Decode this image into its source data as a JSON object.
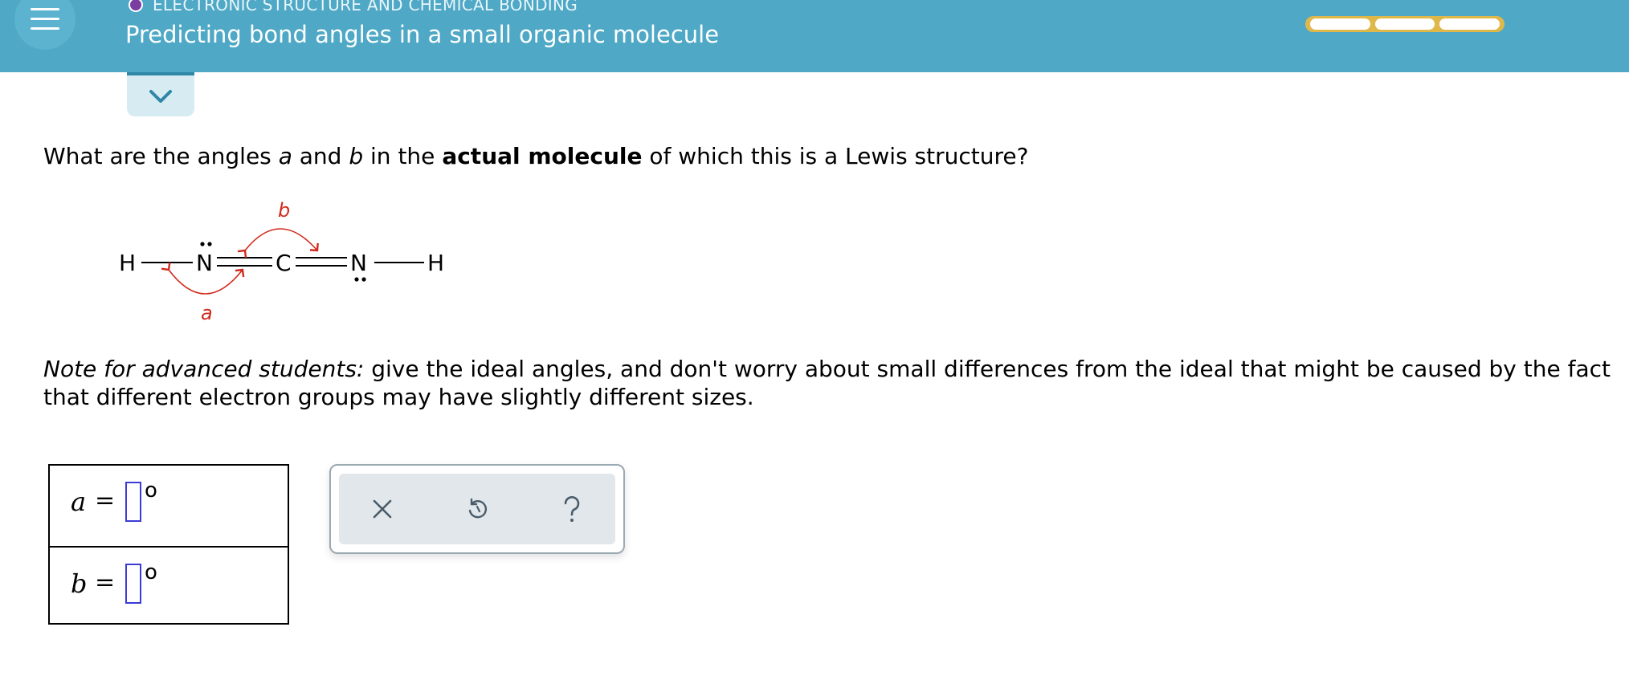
{
  "header": {
    "category": "ELECTRONIC STRUCTURE AND CHEMICAL BONDING",
    "title": "Predicting bond angles in a small organic molecule",
    "progress_segments": 3,
    "progress_filled": 0,
    "accent_color": "#4ea8c6",
    "progress_color": "#e0b84a"
  },
  "question": {
    "text_1": "What are the angles ",
    "var_a": "a",
    "text_2": " and ",
    "var_b": "b",
    "text_3": " in the ",
    "bold": "actual molecule",
    "text_4": " of which this is a Lewis structure?"
  },
  "molecule": {
    "atoms": [
      "H",
      "N",
      "C",
      "N",
      "H"
    ],
    "angle_label_a": "a",
    "angle_label_b": "b",
    "angle_color": "#d12a1c"
  },
  "note": {
    "italic": "Note for advanced students:",
    "text": " give the ideal angles, and don't worry about small differences from the ideal that might be caused by the fact that different electron groups may have slightly different sizes."
  },
  "answers": [
    {
      "variable": "a",
      "equals": "=",
      "value": "",
      "unit": "o"
    },
    {
      "variable": "b",
      "equals": "=",
      "value": "",
      "unit": "o"
    }
  ],
  "toolbox": {
    "clear_icon": "x-icon",
    "undo_icon": "undo-icon",
    "help_icon": "question-icon"
  }
}
